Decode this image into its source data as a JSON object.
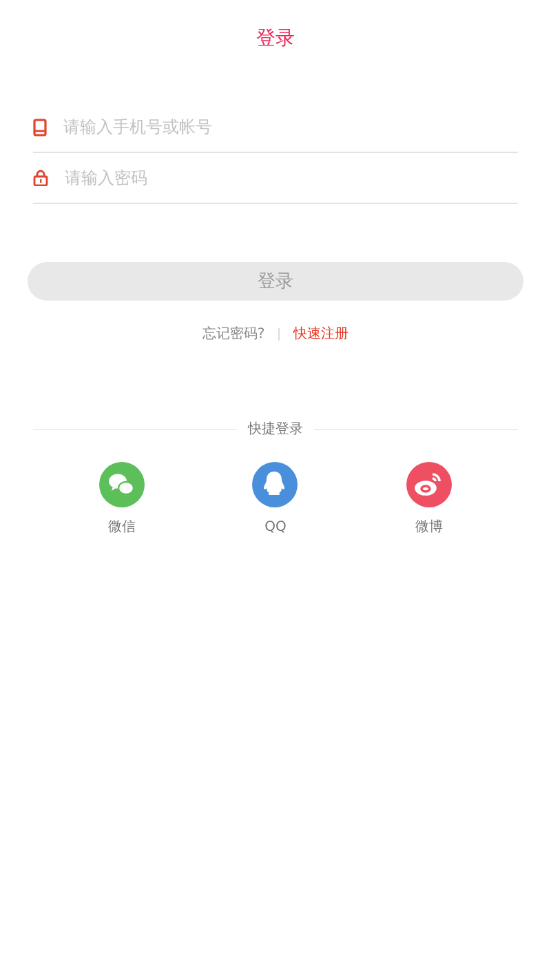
{
  "title": "登录",
  "fields": [
    {
      "kind": "phone",
      "placeholder": "请输入手机号或帐号"
    },
    {
      "kind": "lock",
      "placeholder": "请输入密码"
    }
  ],
  "login_button": {
    "label": "登录",
    "disabled": true
  },
  "links": {
    "forgot": "忘记密码?",
    "register": "快速注册"
  },
  "quick_login": {
    "heading": "快捷登录",
    "items": [
      {
        "kind": "wechat",
        "label": "微信",
        "color": "#5cbf5a"
      },
      {
        "kind": "qq",
        "label": "QQ",
        "color": "#4a8fdb"
      },
      {
        "kind": "weibo",
        "label": "微博",
        "color": "#ee4f63"
      }
    ]
  }
}
